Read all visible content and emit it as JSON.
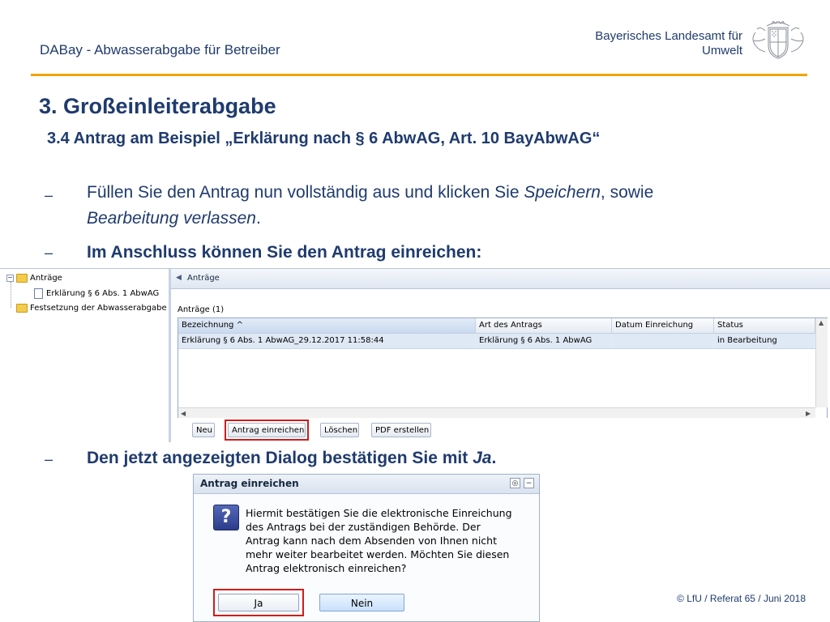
{
  "header": {
    "title": "DABay - Abwasserabgabe für Betreiber",
    "org_line1": "Bayerisches Landesamt für",
    "org_line2": "Umwelt",
    "logo": "bavarian-crest-icon"
  },
  "heading": "3. Großeinleiterabgabe",
  "subheading": "3.4 Antrag am Beispiel „Erklärung nach  § 6 AbwAG, Art. 10 BayAbwAG“",
  "bullets": {
    "b1_part1": "Füllen Sie den Antrag nun vollständig aus und klicken Sie ",
    "b1_italic1": "Speichern",
    "b1_part2": ", sowie ",
    "b1_italic2": "Bearbeitung verlassen",
    "b1_part3": ".",
    "b2": "Im Anschluss können Sie den Antrag einreichen:",
    "b3_part1": "Den jetzt angezeigten Dialog bestätigen Sie mit ",
    "b3_italic": "Ja",
    "b3_part2": "."
  },
  "app": {
    "tree": {
      "root": "Anträge",
      "child": "Erklärung § 6 Abs. 1 AbwAG",
      "sibling": "Festsetzung der Abwasserabgabe"
    },
    "panel_title": "Anträge",
    "grid_caption": "Anträge (1)",
    "columns": [
      "Bezeichnung",
      "Art des Antrags",
      "Datum Einreichung",
      "Status"
    ],
    "sort_indicator": "^",
    "rows": [
      {
        "bezeichnung": "Erklärung § 6 Abs. 1 AbwAG_29.12.2017 11:58:44",
        "art": "Erklärung § 6 Abs. 1 AbwAG",
        "datum": "",
        "status": "in Bearbeitung"
      }
    ],
    "buttons": {
      "neu": "Neu",
      "einreichen": "Antrag einreichen",
      "loeschen": "Löschen",
      "pdf": "PDF erstellen"
    }
  },
  "dialog": {
    "title": "Antrag einreichen",
    "icon": "question-icon",
    "icon_glyph": "?",
    "message": [
      "Hiermit bestätigen Sie die elektronische Einreichung",
      "des Antrags bei der zuständigen Behörde. Der",
      "Antrag kann nach dem Absenden von Ihnen nicht",
      "mehr weiter bearbeitet werden. Möchten Sie diesen",
      "Antrag elektronisch einreichen?"
    ],
    "ja": "Ja",
    "nein": "Nein"
  },
  "footer": "© LfU / Referat 65 / Juni 2018",
  "colors": {
    "text_blue": "#1f3b6e",
    "accent_orange": "#f0a500",
    "highlight_red": "#d01c1c",
    "selected_row": "#dfe9f5"
  }
}
